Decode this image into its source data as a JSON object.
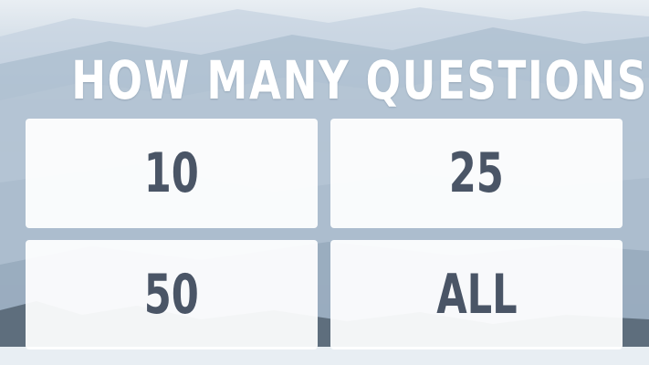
{
  "prompt": "HOW MANY QUESTIONS?",
  "options": [
    {
      "label": "10"
    },
    {
      "label": "25"
    },
    {
      "label": "50"
    },
    {
      "label": "ALL"
    }
  ],
  "colors": {
    "title_text": "#ffffff",
    "option_background": "#ffffff",
    "option_text": "#4a5566"
  }
}
